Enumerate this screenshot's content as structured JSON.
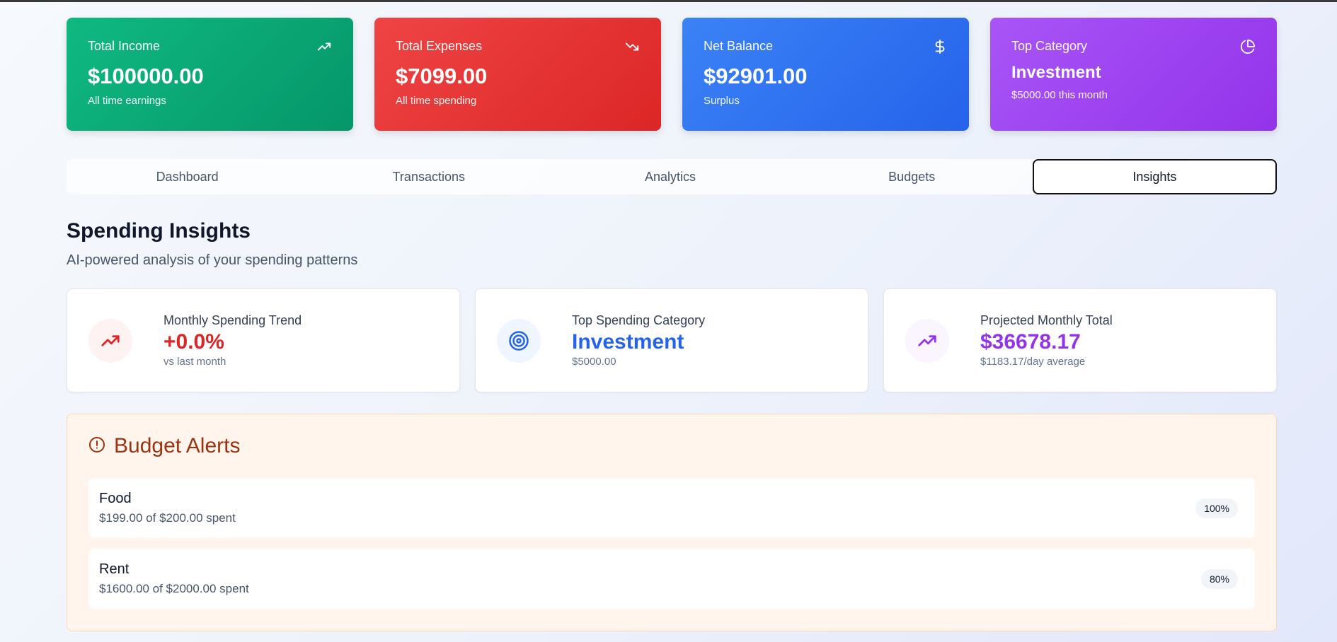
{
  "stats": [
    {
      "label": "Total Income",
      "value": "$100000.00",
      "sub": "All time earnings",
      "icon": "trending-up-icon",
      "color": "#10b981"
    },
    {
      "label": "Total Expenses",
      "value": "$7099.00",
      "sub": "All time spending",
      "icon": "trending-down-icon",
      "color": "#ef4444"
    },
    {
      "label": "Net Balance",
      "value": "$92901.00",
      "sub": "Surplus",
      "icon": "dollar-icon",
      "color": "#3b82f6"
    },
    {
      "label": "Top Category",
      "value": "Investment",
      "sub": "$5000.00 this month",
      "icon": "pie-chart-icon",
      "color": "#a855f7"
    }
  ],
  "tabs": [
    "Dashboard",
    "Transactions",
    "Analytics",
    "Budgets",
    "Insights"
  ],
  "active_tab": "Insights",
  "insights_section": {
    "title": "Spending Insights",
    "subtitle": "AI-powered analysis of your spending patterns"
  },
  "insight_cards": [
    {
      "label": "Monthly Spending Trend",
      "value": "+0.0%",
      "sub": "vs last month",
      "icon": "trending-up-icon",
      "color": "#dc2626"
    },
    {
      "label": "Top Spending Category",
      "value": "Investment",
      "sub": "$5000.00",
      "icon": "target-icon",
      "color": "#2563eb"
    },
    {
      "label": "Projected Monthly Total",
      "value": "$36678.17",
      "sub": "$1183.17/day average",
      "icon": "trending-up-icon",
      "color": "#9333ea"
    }
  ],
  "budget_alerts": {
    "title": "Budget Alerts",
    "icon": "alert-circle-icon",
    "items": [
      {
        "name": "Food",
        "detail": "$199.00 of $200.00 spent",
        "percent": "100%"
      },
      {
        "name": "Rent",
        "detail": "$1600.00 of $2000.00 spent",
        "percent": "80%"
      }
    ]
  }
}
